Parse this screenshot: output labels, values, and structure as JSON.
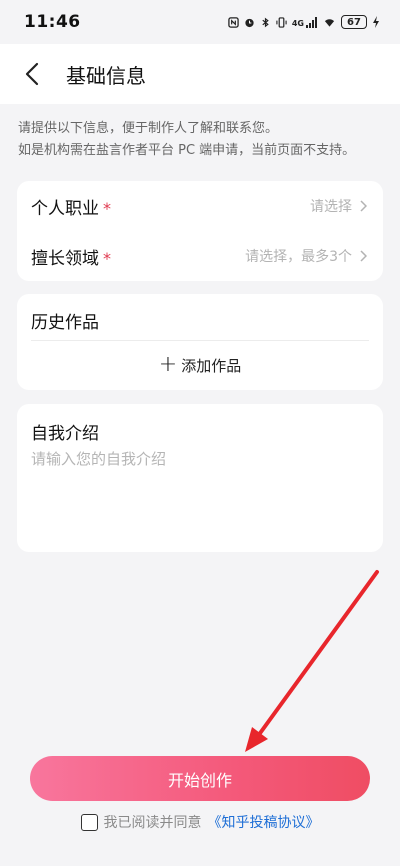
{
  "status_bar": {
    "time": "11:46",
    "battery": "67",
    "icons": [
      "nfc-icon",
      "alarm-icon",
      "bluetooth-icon",
      "vibrate-icon",
      "signal-4g-icon",
      "wifi-icon"
    ],
    "network_label": "4G"
  },
  "nav": {
    "title": "基础信息",
    "back_icon": "chevron-left-icon"
  },
  "intro": {
    "line1": "请提供以下信息，便于制作人了解和联系您。",
    "line2": "如是机构需在盐言作者平台 PC 端申请，当前页面不支持。"
  },
  "fields": {
    "occupation": {
      "label": "个人职业",
      "required_mark": "*",
      "placeholder": "请选择"
    },
    "expertise": {
      "label": "擅长领域",
      "required_mark": "*",
      "placeholder": "请选择，最多3个"
    }
  },
  "history": {
    "title": "历史作品",
    "add_label": "添加作品"
  },
  "self_intro": {
    "title": "自我介绍",
    "placeholder": "请输入您的自我介绍",
    "value": ""
  },
  "actions": {
    "start_label": "开始创作",
    "agree_text": "我已阅读并同意",
    "agreement_link": "《知乎投稿协议》"
  },
  "colors": {
    "accent": "#f4597a",
    "required": "#e0394f",
    "link": "#1f6fd6",
    "annotation_arrow": "#e8262c"
  }
}
